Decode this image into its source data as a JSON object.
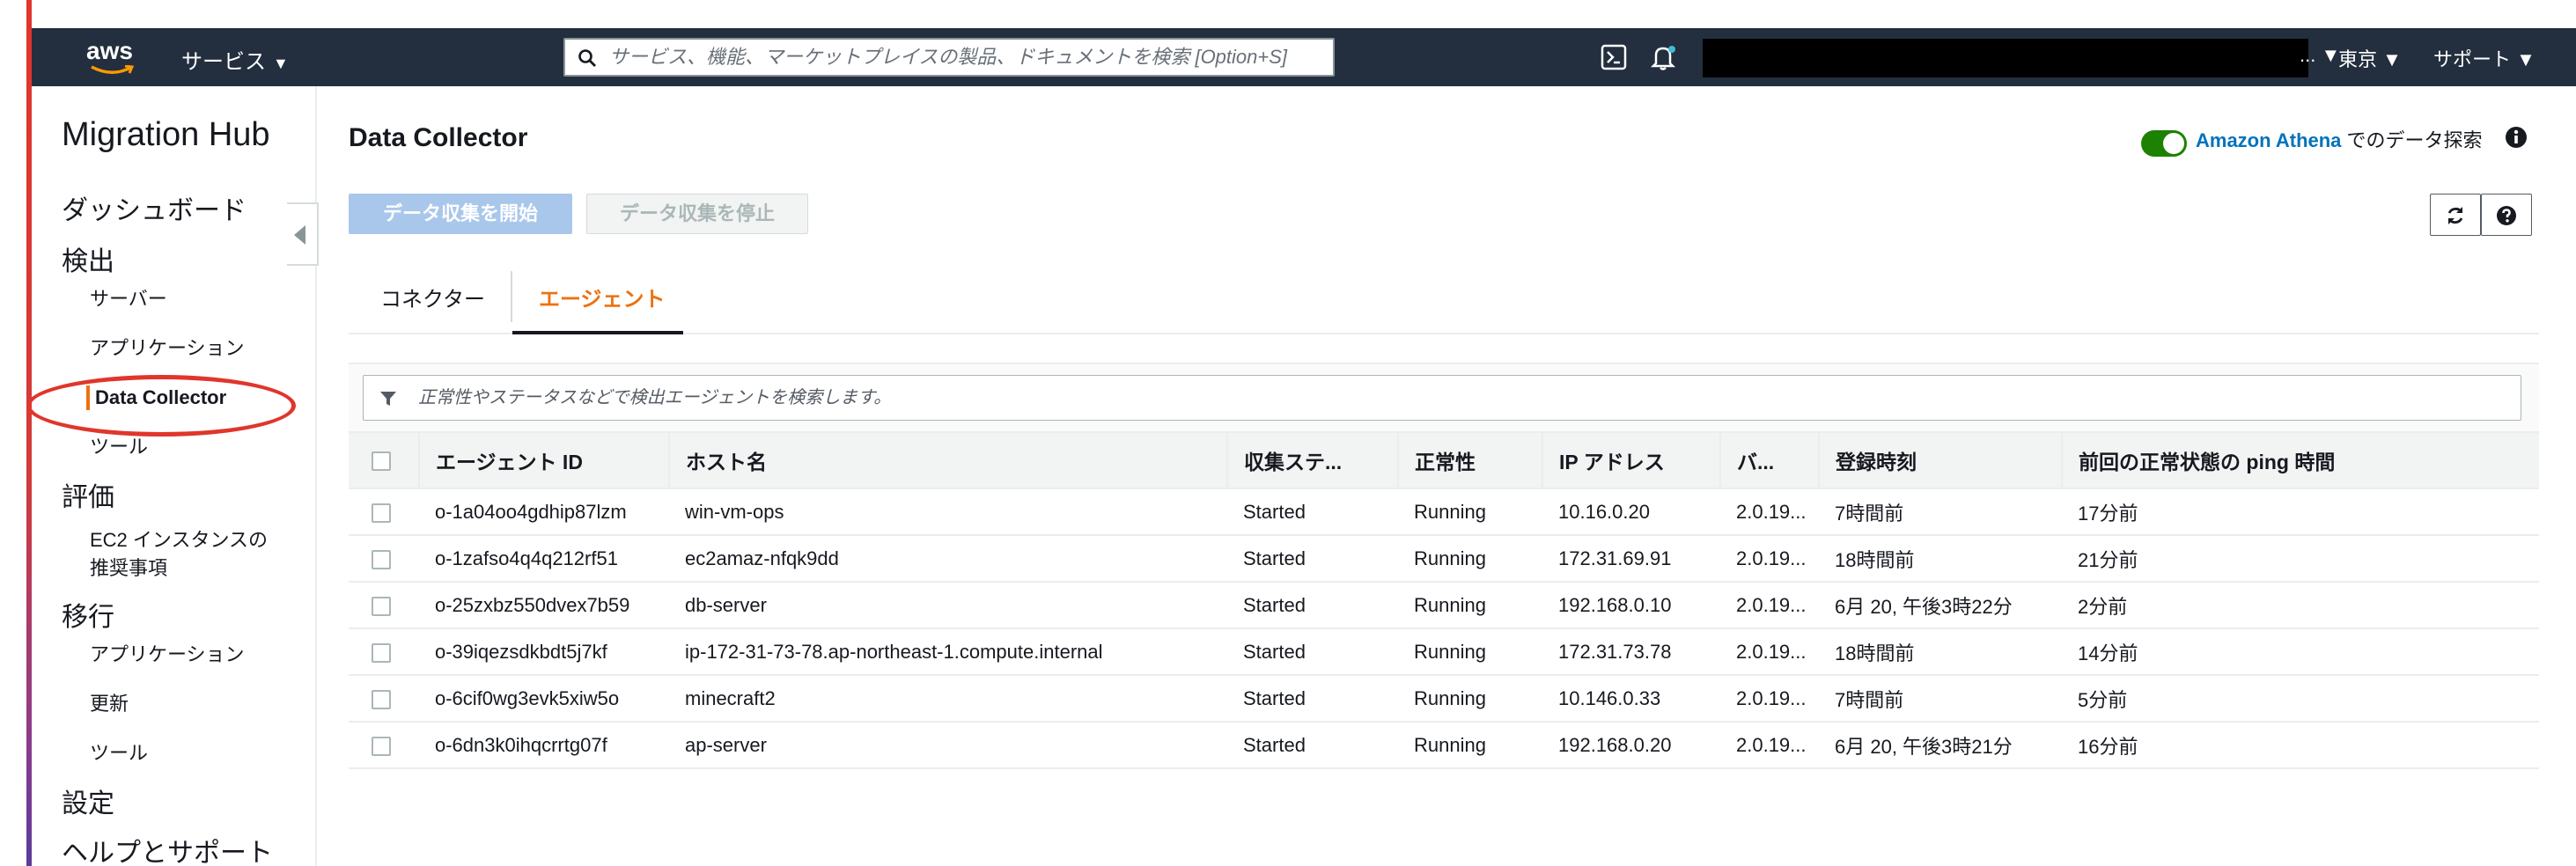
{
  "topnav": {
    "logo_text": "aws",
    "services_label": "サービス",
    "search_placeholder": "サービス、機能、マーケットプレイスの製品、ドキュメントを検索 [Option+S]",
    "account_caret": "... ▼",
    "region_label": "東京 ▼",
    "support_label": "サポート ▼"
  },
  "sidebar": {
    "title": "Migration Hub",
    "dashboard": "ダッシュボード",
    "sections": [
      {
        "heading": "検出",
        "items": [
          "サーバー",
          "アプリケーション",
          "Data Collector",
          "ツール"
        ]
      },
      {
        "heading": "評価",
        "items": [
          "EC2 インスタンスの",
          "推奨事項"
        ]
      },
      {
        "heading": "移行",
        "items": [
          "アプリケーション",
          "更新",
          "ツール"
        ]
      }
    ],
    "settings": "設定",
    "help": "ヘルプとサポート"
  },
  "main": {
    "title": "Data Collector",
    "athena_link": "Amazon Athena",
    "athena_suffix": " でのデータ探索",
    "start_button": "データ収集を開始",
    "stop_button": "データ収集を停止",
    "tabs": [
      "コネクター",
      "エージェント"
    ],
    "filter_placeholder": "正常性やステータスなどで検出エージェントを検索します。"
  },
  "table": {
    "columns": [
      "エージェント ID",
      "ホスト名",
      "収集ステ...",
      "正常性",
      "IP アドレス",
      "バ...",
      "登録時刻",
      "前回の正常状態の ping 時間"
    ],
    "rows": [
      [
        "o-1a04oo4gdhip87lzm",
        "win-vm-ops",
        "Started",
        "Running",
        "10.16.0.20",
        "2.0.19...",
        "7時間前",
        "17分前"
      ],
      [
        "o-1zafso4q4q212rf51",
        "ec2amaz-nfqk9dd",
        "Started",
        "Running",
        "172.31.69.91",
        "2.0.19...",
        "18時間前",
        "21分前"
      ],
      [
        "o-25zxbz550dvex7b59",
        "db-server",
        "Started",
        "Running",
        "192.168.0.10",
        "2.0.19...",
        "6月 20, 午後3時22分",
        "2分前"
      ],
      [
        "o-39iqezsdkbdt5j7kf",
        "ip-172-31-73-78.ap-northeast-1.compute.internal",
        "Started",
        "Running",
        "172.31.73.78",
        "2.0.19...",
        "18時間前",
        "14分前"
      ],
      [
        "o-6cif0wg3evk5xiw5o",
        "minecraft2",
        "Started",
        "Running",
        "10.146.0.33",
        "2.0.19...",
        "7時間前",
        "5分前"
      ],
      [
        "o-6dn3k0ihqcrrtg07f",
        "ap-server",
        "Started",
        "Running",
        "192.168.0.20",
        "2.0.19...",
        "6月 20, 午後3時21分",
        "16分前"
      ]
    ]
  },
  "colors": {
    "nav_bg": "#232f3e",
    "accent_orange": "#ec7211",
    "link_blue": "#0073bb",
    "toggle_green": "#1d8102",
    "annotation_red": "#e0362b"
  }
}
